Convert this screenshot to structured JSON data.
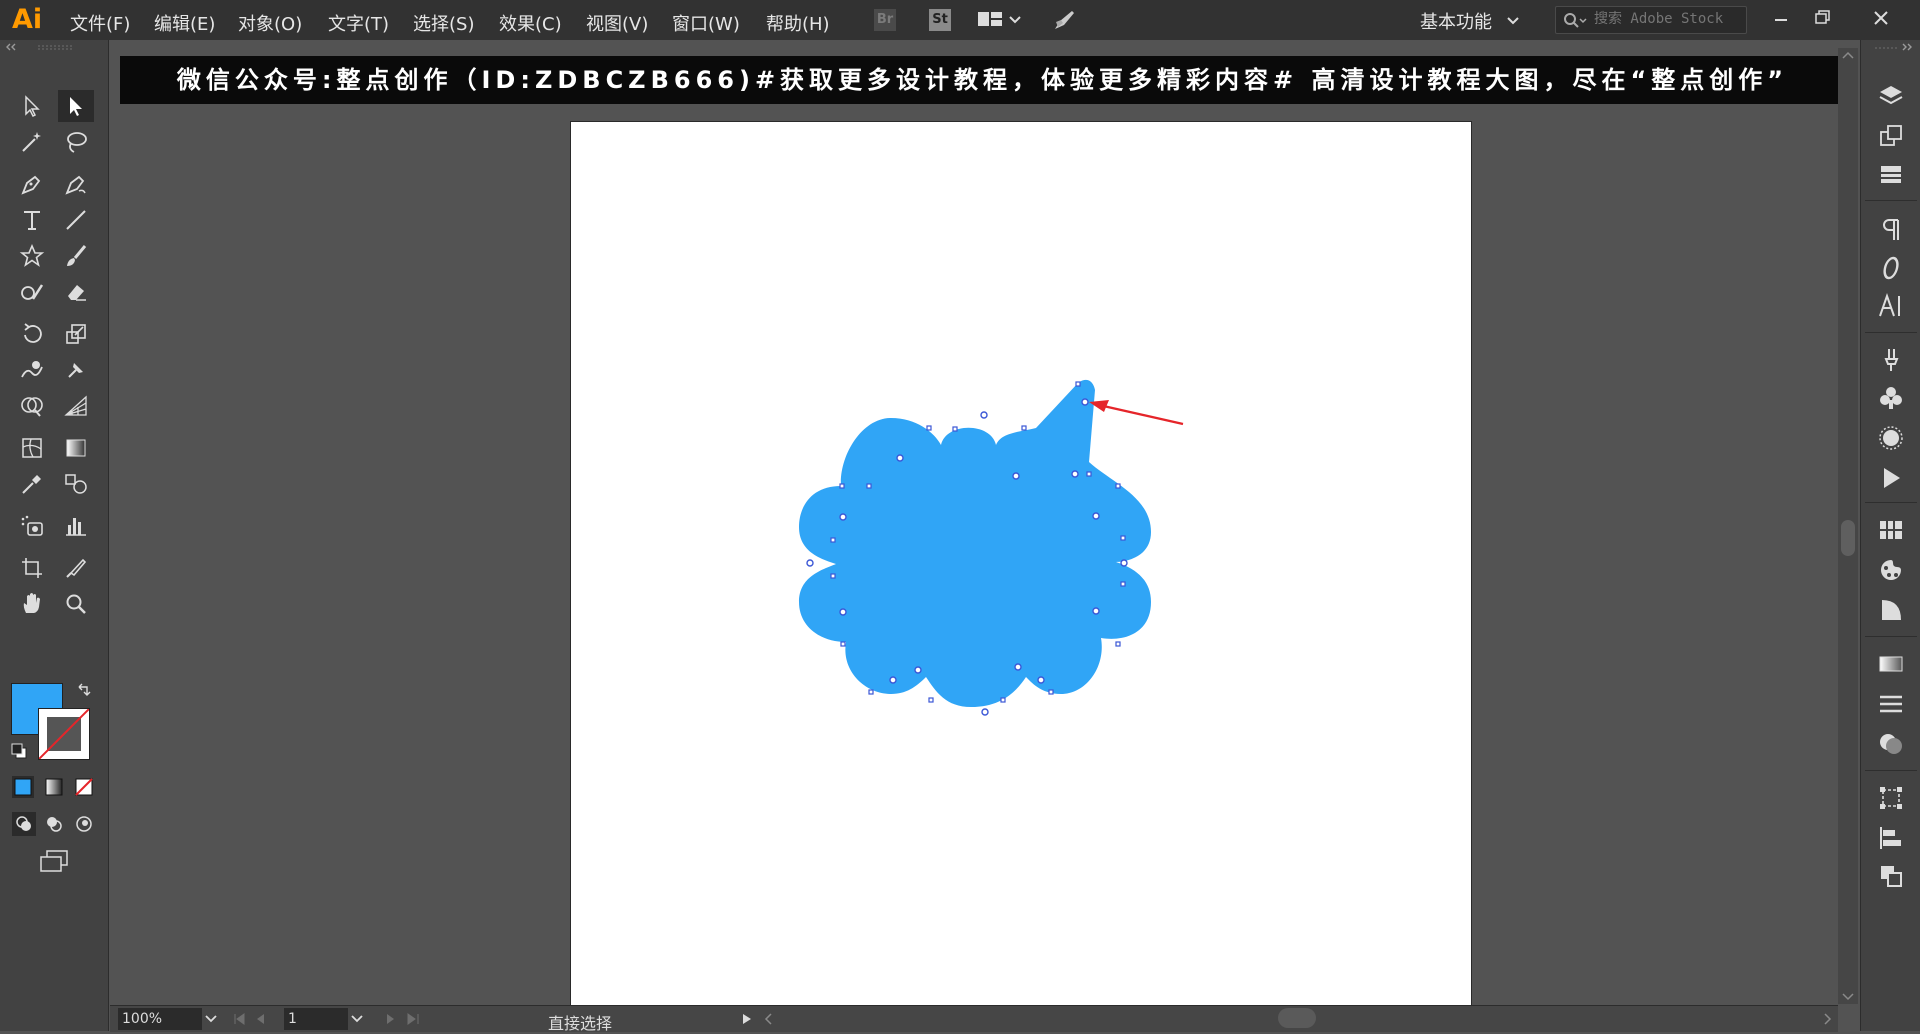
{
  "app": {
    "logo": "Ai"
  },
  "menu": [
    {
      "label": "文件(F)"
    },
    {
      "label": "编辑(E)"
    },
    {
      "label": "对象(O)"
    },
    {
      "label": "文字(T)"
    },
    {
      "label": "选择(S)"
    },
    {
      "label": "效果(C)"
    },
    {
      "label": "视图(V)"
    },
    {
      "label": "窗口(W)"
    },
    {
      "label": "帮助(H)"
    }
  ],
  "icons": {
    "bridge": "Br",
    "stock": "St"
  },
  "workspace": {
    "label": "基本功能"
  },
  "search": {
    "placeholder": "搜索 Adobe Stock"
  },
  "banner": {
    "text": "微信公众号:整点创作（ID:ZDBCZB666)#获取更多设计教程，体验更多精彩内容#  高清设计教程大图，尽在“整点创作”"
  },
  "status": {
    "zoom": "100%",
    "page": "1",
    "tool": "直接选择"
  },
  "colors": {
    "fill": "#30a5f6",
    "accent": "#ff9a00",
    "anchor": "#3b57d6",
    "arrow": "#e5252a"
  }
}
